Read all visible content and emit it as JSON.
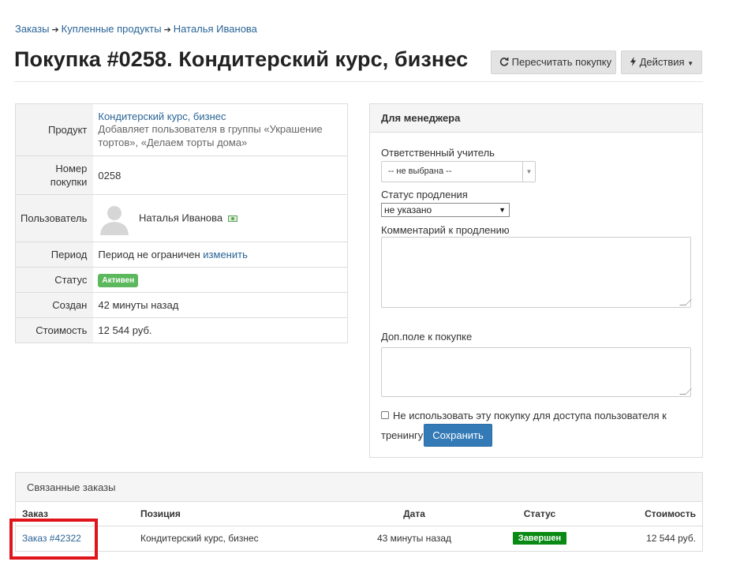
{
  "breadcrumb": {
    "item1": "Заказы",
    "item2": "Купленные продукты",
    "item3": "Наталья Иванова",
    "sep": "➔"
  },
  "title": "Покупка #0258. Кондитерский курс, бизнес",
  "toolbar": {
    "recalc_label": "Пересчитать покупку",
    "actions_label": "Действия"
  },
  "info": {
    "product_label": "Продукт",
    "product_name": "Кондитерский курс, бизнес",
    "product_desc": "Добавляет пользователя в группы «Украшение тортов», «Делаем торты дома»",
    "number_label": "Номер покупки",
    "number_value": "0258",
    "user_label": "Пользователь",
    "user_name": "Наталья Иванова",
    "period_label": "Период",
    "period_value": "Период не ограничен",
    "period_change": "изменить",
    "status_label": "Статус",
    "status_value": "Активен",
    "created_label": "Создан",
    "created_value": "42 минуты назад",
    "cost_label": "Стоимость",
    "cost_value": "12 544 руб."
  },
  "manager": {
    "title": "Для менеджера",
    "teacher_label": "Ответственный учитель",
    "teacher_value": "-- не выбрана --",
    "renew_status_label": "Статус продления",
    "renew_status_value": "не указано",
    "renew_comment_label": "Комментарий к продлению",
    "extra_field_label": "Доп.поле к покупке",
    "checkbox_label_1": "Не использовать эту покупку для доступа пользователя к",
    "checkbox_label_2": "тренингу",
    "save_label": "Сохранить"
  },
  "related": {
    "title": "Связанные заказы",
    "columns": [
      "Заказ",
      "Позиция",
      "Дата",
      "Статус",
      "Стоимость"
    ],
    "rows": [
      {
        "order": "Заказ #42322",
        "position": "Кондитерский курс, бизнес",
        "date": "43 минуты назад",
        "status": "Завершен",
        "cost": "12 544 руб."
      }
    ]
  },
  "colors": {
    "link": "#2a6496",
    "primary_button": "#337ab7",
    "active_badge": "#5cb85c",
    "done_badge": "#0a8a14",
    "highlight": "#e0141b"
  }
}
